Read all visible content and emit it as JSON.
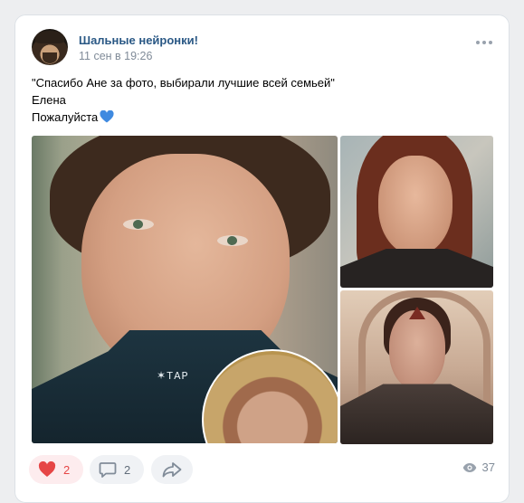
{
  "post": {
    "group_name": "Шальные нейронки!",
    "time": "11 сен в 19:26",
    "lines": [
      "\"Спасибо Ане за фото, выбирали лучшие всей семьей\"",
      "Елена",
      "Пожалуйста"
    ],
    "emoji": "blue-heart",
    "photo_text": "✶ΤΑΡ"
  },
  "actions": {
    "likes": "2",
    "comments": "2",
    "views": "37"
  },
  "colors": {
    "link": "#2a5885",
    "like_red": "#e64646",
    "heart_blue": "#3f8ae0",
    "muted": "#818c99"
  }
}
